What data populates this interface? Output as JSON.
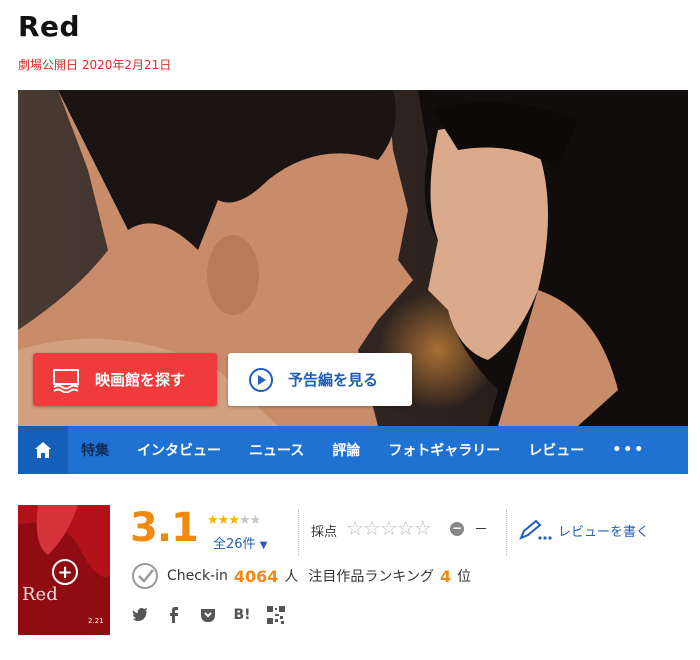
{
  "movie": {
    "title": "Red",
    "release": "劇場公開日 2020年2月21日"
  },
  "hero": {
    "buttons": {
      "find_theater": "映画館を探す",
      "trailer": "予告編を見る"
    }
  },
  "nav": {
    "items": [
      {
        "label": "特集",
        "active": true
      },
      {
        "label": "インタビュー"
      },
      {
        "label": "ニュース"
      },
      {
        "label": "評論"
      },
      {
        "label": "フォトギャラリー"
      },
      {
        "label": "レビュー"
      },
      {
        "label": "•••"
      }
    ]
  },
  "poster": {
    "text": "Red",
    "date": "2.21"
  },
  "rating": {
    "score": "3.1",
    "stars_filled": 3,
    "stars_total": 5,
    "review_count": "全26件",
    "rate_label": "採点",
    "rate_value": "－",
    "review_button": "レビューを書く"
  },
  "stats": {
    "checkin_label": "Check-in",
    "checkin_count": "4064",
    "checkin_unit": "人",
    "ranking_label": "注目作品ランキング",
    "ranking_value": "4",
    "ranking_unit": "位"
  },
  "share": [
    "twitter-icon",
    "facebook-icon",
    "pocket-icon",
    "hatena-icon",
    "qr-code-icon"
  ],
  "share_labels": {
    "hatena": "B!"
  },
  "colors": {
    "accent_orange": "#f08a11",
    "nav_blue": "#1f72d2",
    "theater_red": "#ef3b3b",
    "link_blue": "#1f5fb8",
    "release_red": "#d92b2b"
  }
}
